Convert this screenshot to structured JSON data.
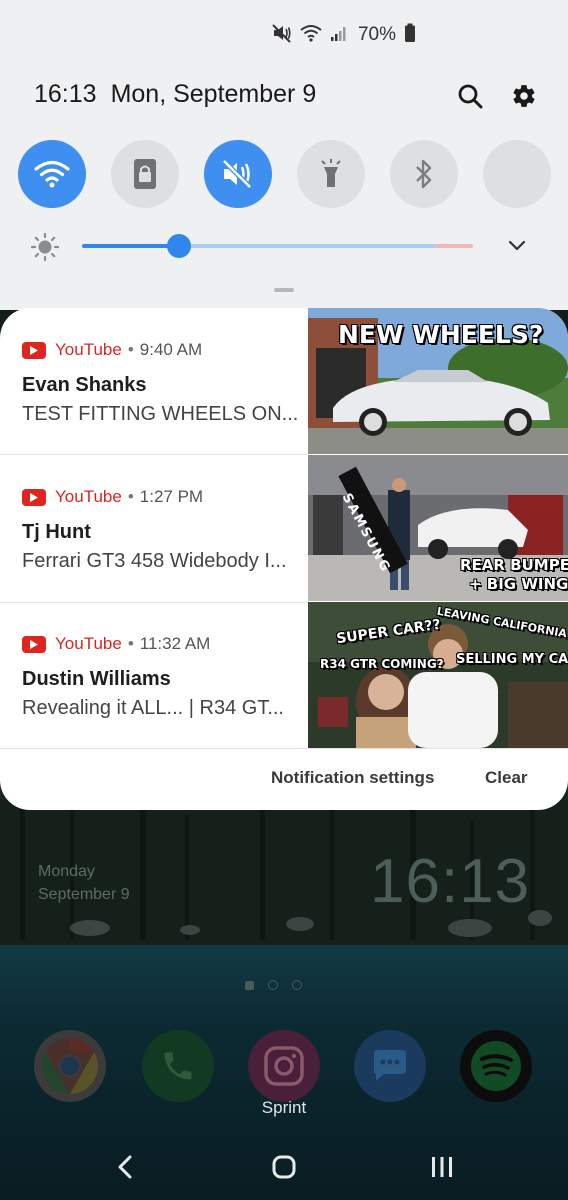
{
  "status_bar": {
    "battery": "70%"
  },
  "quick_panel": {
    "time": "16:13",
    "date": "Mon, September 9",
    "tiles": [
      "wifi",
      "screen-lock",
      "mute",
      "flashlight",
      "bluetooth",
      "empty"
    ],
    "brightness_level": 0.25
  },
  "notifications": [
    {
      "app": "YouTube",
      "time": "9:40 AM",
      "title": "Evan Shanks",
      "text": "TEST FITTING WHEELS ON...",
      "thumb_captions": [
        "NEW WHEELS?"
      ]
    },
    {
      "app": "YouTube",
      "time": "1:27 PM",
      "title": "Tj Hunt",
      "text": "Ferrari GT3 458 Widebody I...",
      "thumb_captions": [
        "REAR BUMPER",
        "+ BIG WING!",
        "SAMSUNG"
      ]
    },
    {
      "app": "YouTube",
      "time": "11:32 AM",
      "title": "Dustin Williams",
      "text": "Revealing it ALL... | R34 GT...",
      "thumb_captions": [
        "SUPER CAR??",
        "LEAVING CALIFORNIA",
        "R34 GTR COMING?",
        "SELLING MY CAR..."
      ]
    }
  ],
  "card_actions": {
    "settings": "Notification settings",
    "clear": "Clear"
  },
  "home": {
    "day": "Monday",
    "date": "September 9",
    "clock": "16:13",
    "dock_label": "Sprint",
    "apps": [
      "chrome-icon",
      "phone-icon",
      "instagram-icon",
      "messages-icon",
      "spotify-icon"
    ]
  }
}
